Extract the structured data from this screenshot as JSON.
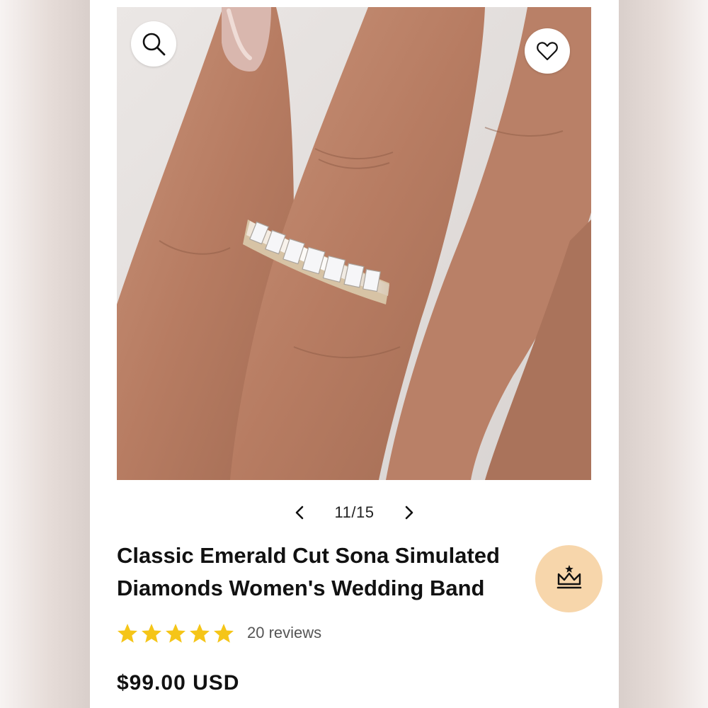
{
  "gallery": {
    "counter": "11/15",
    "image_subject": "hand-with-ring"
  },
  "icons": {
    "search": "search-icon",
    "wishlist": "heart-icon",
    "prev": "chevron-left-icon",
    "next": "chevron-right-icon",
    "crown": "crown-icon",
    "star": "star-icon"
  },
  "product": {
    "title": "Classic Emerald Cut Sona Simulated Diamonds Women's Wedding Band",
    "rating_stars": 5,
    "reviews_label": "20 reviews",
    "price": "$99.00 USD"
  },
  "colors": {
    "star": "#f5c518",
    "crown_badge_bg": "#f7d6ab",
    "text": "#111111"
  }
}
